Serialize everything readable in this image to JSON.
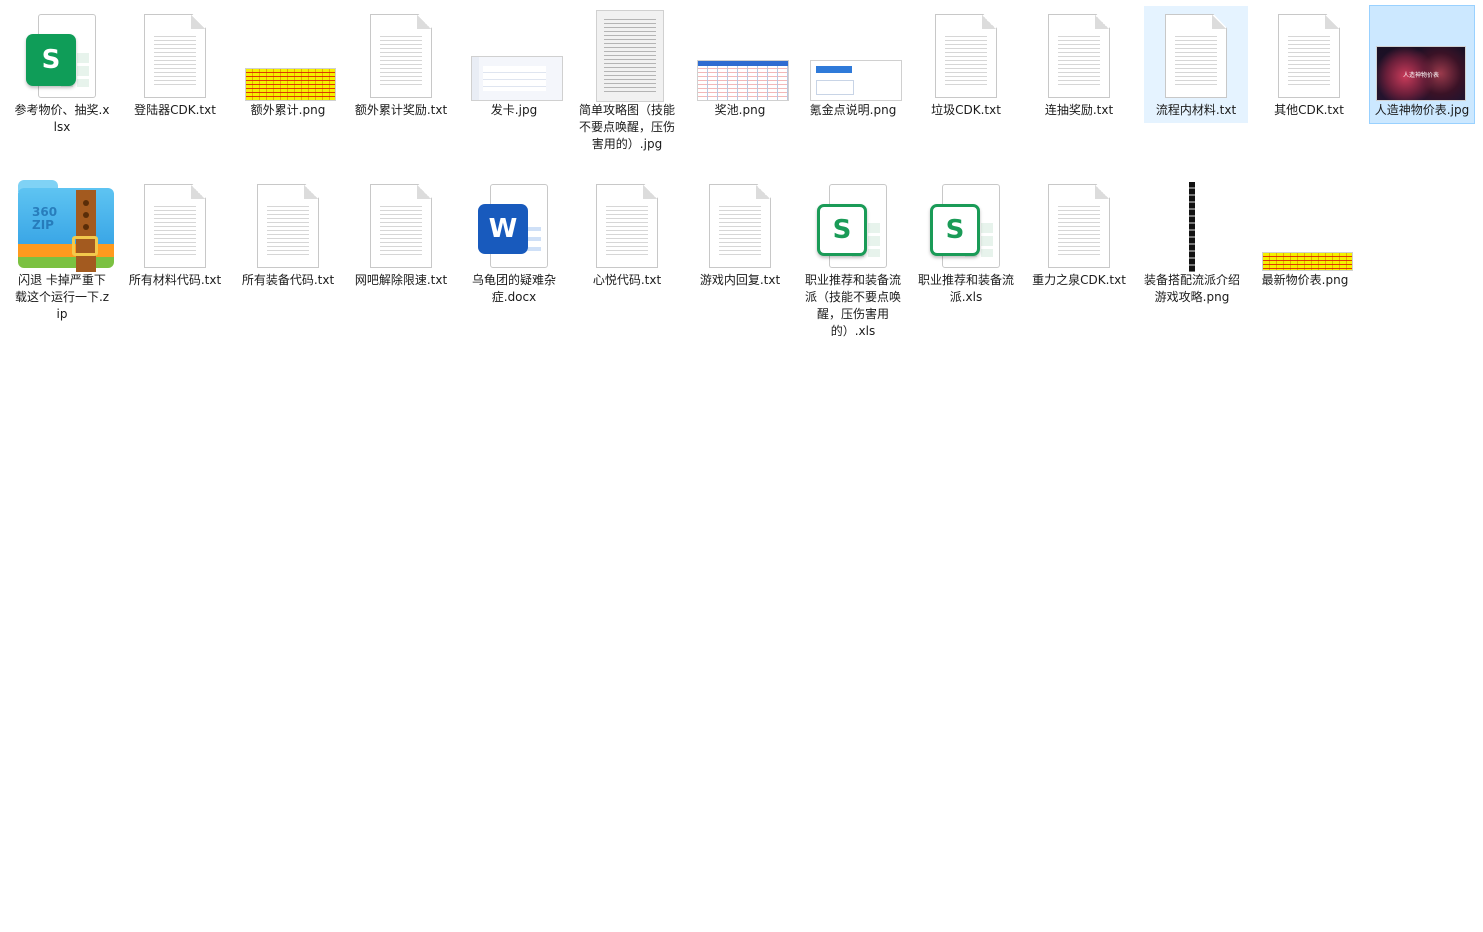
{
  "files": [
    {
      "name": "参考物价、抽奖.xlsx",
      "icon": "spreadsheet-icon"
    },
    {
      "name": "登陆器CDK.txt",
      "icon": "text-file-icon"
    },
    {
      "name": "额外累计.png",
      "icon": "image-thumbnail"
    },
    {
      "name": "额外累计奖励.txt",
      "icon": "text-file-icon"
    },
    {
      "name": "发卡.jpg",
      "icon": "image-thumbnail"
    },
    {
      "name": "简单攻略图（技能不要点唤醒，压伤害用的）.jpg",
      "icon": "image-thumbnail"
    },
    {
      "name": "奖池.png",
      "icon": "image-thumbnail"
    },
    {
      "name": "氪金点说明.png",
      "icon": "image-thumbnail"
    },
    {
      "name": "垃圾CDK.txt",
      "icon": "text-file-icon"
    },
    {
      "name": "连抽奖励.txt",
      "icon": "text-file-icon"
    },
    {
      "name": "流程内材料.txt",
      "icon": "text-file-icon"
    },
    {
      "name": "其他CDK.txt",
      "icon": "text-file-icon"
    },
    {
      "name": "人造神物价表.jpg",
      "icon": "image-thumbnail"
    },
    {
      "name": "闪退 卡掉严重下载这个运行一下.zip",
      "icon": "zip-archive-icon"
    },
    {
      "name": "所有材料代码.txt",
      "icon": "text-file-icon"
    },
    {
      "name": "所有装备代码.txt",
      "icon": "text-file-icon"
    },
    {
      "name": "网吧解除限速.txt",
      "icon": "text-file-icon"
    },
    {
      "name": "乌龟团的疑难杂症.docx",
      "icon": "word-document-icon"
    },
    {
      "name": "心悦代码.txt",
      "icon": "text-file-icon"
    },
    {
      "name": "游戏内回复.txt",
      "icon": "text-file-icon"
    },
    {
      "name": "职业推荐和装备流派（技能不要点唤醒，压伤害用的）.xls",
      "icon": "spreadsheet-icon"
    },
    {
      "name": "职业推荐和装备流派.xls",
      "icon": "spreadsheet-icon"
    },
    {
      "name": "重力之泉CDK.txt",
      "icon": "text-file-icon"
    },
    {
      "name": "装备搭配流派介绍游戏攻略.png",
      "icon": "image-thumbnail"
    },
    {
      "name": "最新物价表.png",
      "icon": "image-thumbnail"
    }
  ],
  "thumb_caption": "人造神物价表",
  "colors": {
    "hover": "#e5f3ff",
    "selected": "#cce8ff",
    "selected_border": "#99d1ff"
  }
}
